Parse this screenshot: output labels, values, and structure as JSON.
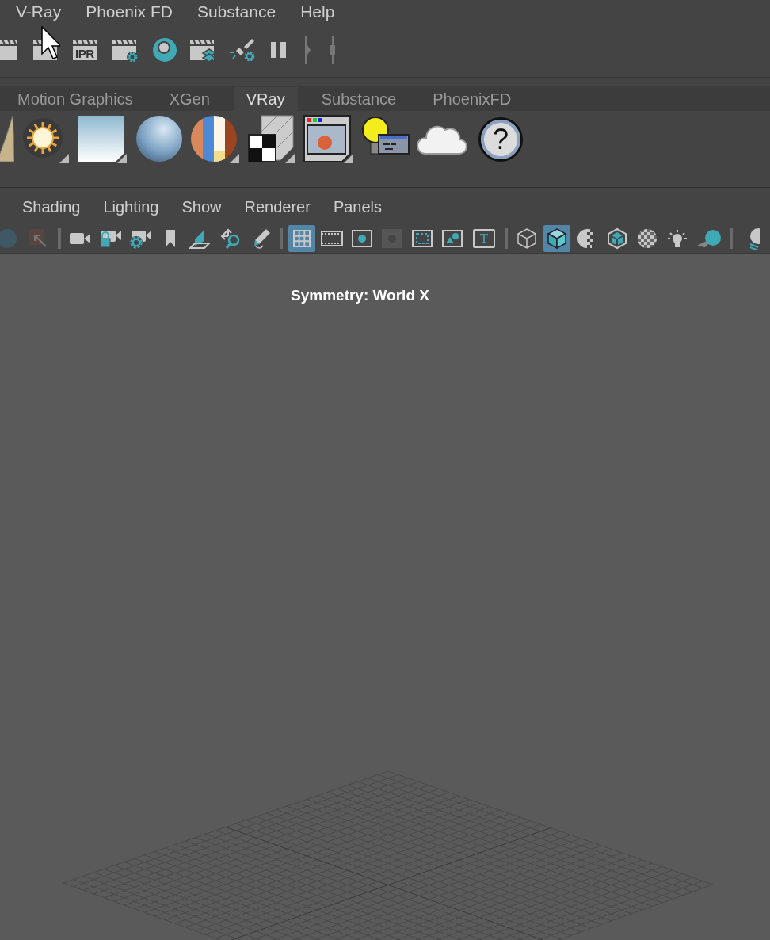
{
  "menubar": {
    "items": [
      "V-Ray",
      "Phoenix FD",
      "Substance",
      "Help"
    ]
  },
  "status_toolbar": [
    {
      "kind": "clapper-partial"
    },
    {
      "kind": "clapper"
    },
    {
      "kind": "clapper-text",
      "label": "IPR"
    },
    {
      "kind": "clapper-gear"
    },
    {
      "kind": "ring"
    },
    {
      "kind": "clapper-layers"
    },
    {
      "kind": "brush-gear"
    },
    {
      "kind": "pause"
    },
    {
      "kind": "marker-arrow"
    },
    {
      "kind": "marker-line"
    }
  ],
  "shelf": {
    "tabs": [
      {
        "label": "Motion Graphics",
        "selected": false
      },
      {
        "label": "XGen",
        "selected": false
      },
      {
        "label": "VRay",
        "selected": true
      },
      {
        "label": "Substance",
        "selected": false
      },
      {
        "label": "PhoenixFD",
        "selected": false
      }
    ],
    "icons": [
      {
        "kind": "arch"
      },
      {
        "kind": "sun"
      },
      {
        "kind": "sky"
      },
      {
        "kind": "sphere"
      },
      {
        "kind": "material-sphere"
      },
      {
        "kind": "checker"
      },
      {
        "kind": "frame-buffer"
      },
      {
        "kind": "light-bulb"
      },
      {
        "kind": "cloud"
      },
      {
        "kind": "help",
        "label": "?"
      }
    ]
  },
  "panel": {
    "menu": [
      "Shading",
      "Lighting",
      "Show",
      "Renderer",
      "Panels"
    ],
    "toolbar": [
      {
        "kind": "dim-sphere",
        "selected": false
      },
      {
        "kind": "dim-arrow",
        "selected": false
      },
      {
        "kind": "separator"
      },
      {
        "kind": "camera",
        "selected": false
      },
      {
        "kind": "camera-lock",
        "selected": false
      },
      {
        "kind": "camera-gear",
        "selected": false
      },
      {
        "kind": "bookmark",
        "selected": false
      },
      {
        "kind": "plane",
        "selected": false
      },
      {
        "kind": "move-magnify",
        "selected": false
      },
      {
        "kind": "pencil",
        "selected": false
      },
      {
        "kind": "separator"
      },
      {
        "kind": "grid",
        "selected": true
      },
      {
        "kind": "film",
        "selected": false
      },
      {
        "kind": "resolution",
        "selected": false
      },
      {
        "kind": "dim-square",
        "selected": false
      },
      {
        "kind": "safe-area",
        "selected": false
      },
      {
        "kind": "image",
        "selected": false
      },
      {
        "kind": "text-frame",
        "label": "T",
        "selected": false
      },
      {
        "kind": "separator"
      },
      {
        "kind": "wire-cube",
        "selected": false
      },
      {
        "kind": "shaded-cube",
        "selected": true
      },
      {
        "kind": "half-checker",
        "selected": false
      },
      {
        "kind": "xray-cube",
        "selected": false
      },
      {
        "kind": "checker-ball",
        "selected": false
      },
      {
        "kind": "bulb",
        "selected": false
      },
      {
        "kind": "shadow-sphere",
        "selected": false
      },
      {
        "kind": "separator"
      },
      {
        "kind": "partial-sphere",
        "selected": false
      }
    ]
  },
  "viewport": {
    "symmetry": "Symmetry: World X"
  }
}
